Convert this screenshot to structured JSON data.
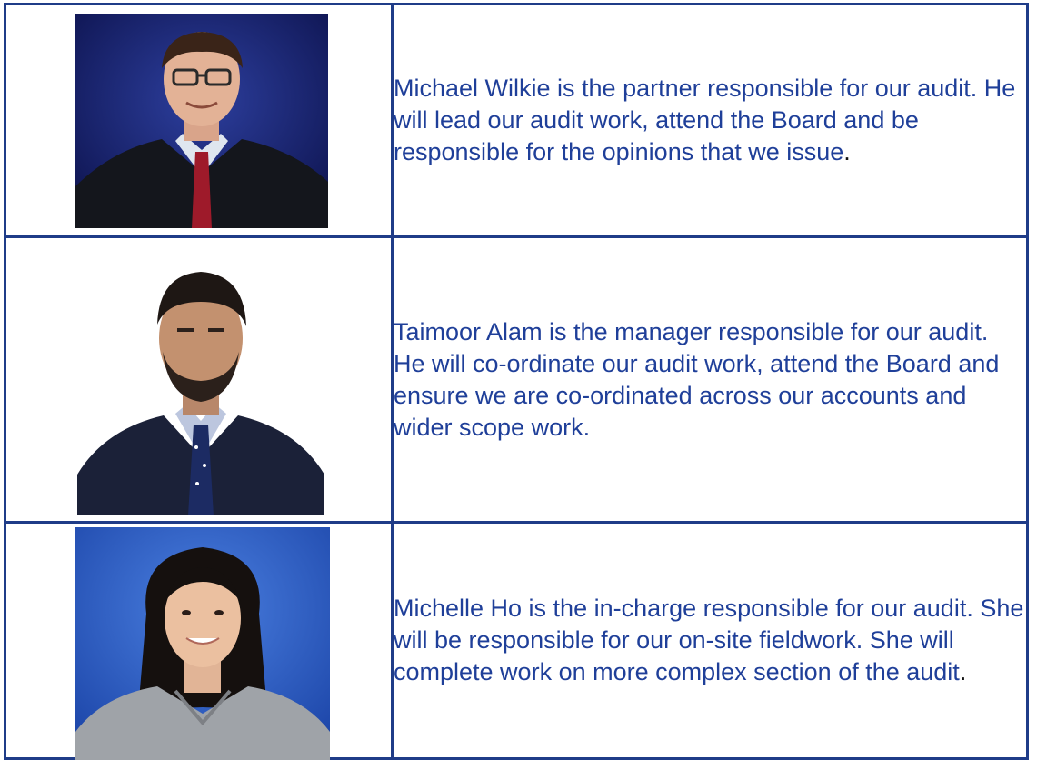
{
  "members": [
    {
      "name": "Michael Wilkie",
      "bio": "Michael Wilkie is the partner responsible for our audit. He will lead our audit work, attend the Board and be responsible for the opinions that we issue",
      "bio_end": ".",
      "photo_icon": "portrait-photo-michael-wilkie"
    },
    {
      "name": "Taimoor Alam",
      "bio": "Taimoor Alam is the manager responsible for our audit. He will co-ordinate our audit work, attend the Board and ensure we are co-ordinated across our accounts and wider scope work.",
      "bio_end": "",
      "photo_icon": "portrait-photo-taimoor-alam"
    },
    {
      "name": "Michelle Ho",
      "bio": "Michelle Ho is the in-charge responsible for our audit. She will be responsible for our on-site fieldwork. She will complete work on more complex section of the audit",
      "bio_end": ".",
      "photo_icon": "portrait-photo-michelle-ho"
    }
  ],
  "colors": {
    "border": "#1f3c88",
    "text": "#1f3f99"
  }
}
